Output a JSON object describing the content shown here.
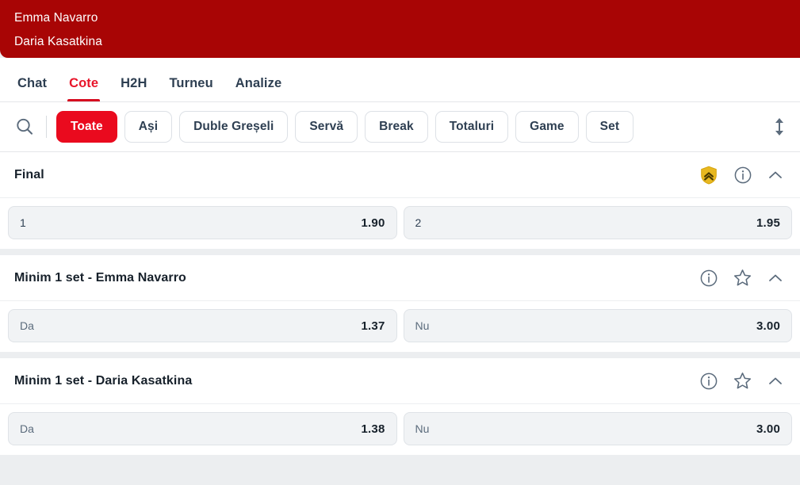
{
  "header": {
    "players": [
      "Emma Navarro",
      "Daria Kasatkina"
    ],
    "bg_color": "#a80505"
  },
  "tabs": [
    {
      "label": "Chat",
      "active": false
    },
    {
      "label": "Cote",
      "active": true
    },
    {
      "label": "H2H",
      "active": false
    },
    {
      "label": "Turneu",
      "active": false
    },
    {
      "label": "Analize",
      "active": false
    }
  ],
  "filters": {
    "search_icon": "search-icon",
    "sort_icon": "sort-updown-icon",
    "chips": [
      {
        "label": "Toate",
        "selected": true
      },
      {
        "label": "Ași",
        "selected": false
      },
      {
        "label": "Duble Greșeli",
        "selected": false
      },
      {
        "label": "Servă",
        "selected": false
      },
      {
        "label": "Break",
        "selected": false
      },
      {
        "label": "Totaluri",
        "selected": false
      },
      {
        "label": "Game",
        "selected": false
      },
      {
        "label": "Set",
        "selected": false
      }
    ]
  },
  "markets": [
    {
      "title": "Final",
      "icons": [
        "boost-shield-icon",
        "info-icon",
        "chevron-up-icon"
      ],
      "has_boost": true,
      "has_star": false,
      "outcomes": [
        {
          "label": "1",
          "value": "1.90"
        },
        {
          "label": "2",
          "value": "1.95"
        }
      ]
    },
    {
      "title": "Minim 1 set - Emma Navarro",
      "icons": [
        "info-icon",
        "star-icon",
        "chevron-up-icon"
      ],
      "has_boost": false,
      "has_star": true,
      "outcomes": [
        {
          "label": "Da",
          "value": "1.37"
        },
        {
          "label": "Nu",
          "value": "3.00"
        }
      ]
    },
    {
      "title": "Minim 1 set - Daria Kasatkina",
      "icons": [
        "info-icon",
        "star-icon",
        "chevron-up-icon"
      ],
      "has_boost": false,
      "has_star": true,
      "outcomes": [
        {
          "label": "Da",
          "value": "1.38"
        },
        {
          "label": "Nu",
          "value": "3.00"
        }
      ]
    }
  ],
  "colors": {
    "header_red": "#a80505",
    "accent_red": "#ea0a1e",
    "tab_active": "#e8152a",
    "boost_gold": "#e8b820",
    "text_dark": "#17212b",
    "page_bg": "#eceef0"
  }
}
